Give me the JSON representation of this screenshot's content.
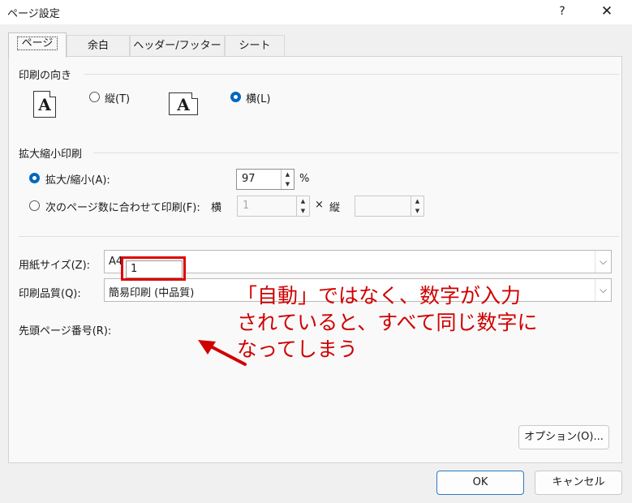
{
  "window": {
    "title": "ページ設定",
    "help_label": "?",
    "close_label": "✕"
  },
  "tabs": [
    {
      "label": "ページ",
      "active": true
    },
    {
      "label": "余白",
      "active": false
    },
    {
      "label": "ヘッダー/フッター",
      "active": false
    },
    {
      "label": "シート",
      "active": false
    }
  ],
  "orientation": {
    "section_label": "印刷の向き",
    "portrait_label": "縦(T)",
    "landscape_label": "横(L)",
    "selected": "landscape",
    "icon_glyph": "A"
  },
  "scaling": {
    "section_label": "拡大縮小印刷",
    "adjust_label": "拡大/縮小(A):",
    "adjust_value": "97",
    "percent_label": "%",
    "fit_label": "次のページ数に合わせて印刷(F):",
    "fit_wide_label": "横",
    "fit_wide_value": "1",
    "times_label": "×",
    "fit_tall_label": "縦",
    "fit_tall_value": "",
    "selected": "adjust"
  },
  "paper_size": {
    "label": "用紙サイズ(Z):",
    "value": "A4"
  },
  "print_quality": {
    "label": "印刷品質(Q):",
    "value": "簡易印刷 (中品質)"
  },
  "first_page": {
    "label": "先頭ページ番号(R):",
    "value": "1"
  },
  "annotation": {
    "line1": "「自動」ではなく、数字が入力",
    "line2": "されていると、すべて同じ数字に",
    "line3": "なってしまう",
    "color": "#d00000"
  },
  "buttons": {
    "options_label": "オプション(O)...",
    "ok_label": "OK",
    "cancel_label": "キャンセル"
  },
  "colors": {
    "accent": "#0067c0",
    "highlight": "#e00000"
  },
  "icons": {
    "spin_up": "▲",
    "spin_down": "▼",
    "dropdown": "⌵"
  }
}
